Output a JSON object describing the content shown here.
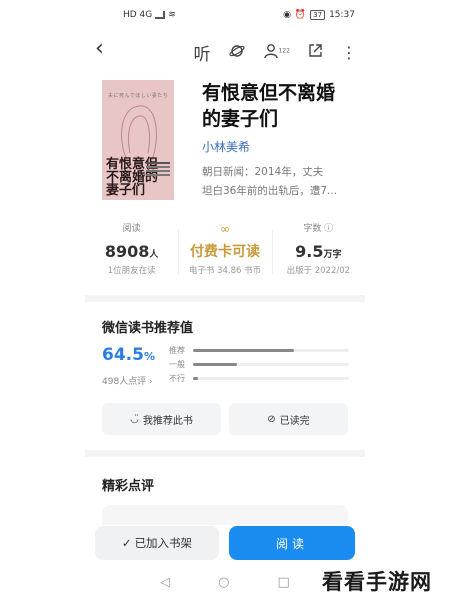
{
  "status_bar": {
    "left_text": "HD 4G",
    "battery": "37",
    "time": "15:37"
  },
  "top_bar": {
    "back_icon": "chevron-left-icon",
    "listen_label": "听",
    "friend_count": "122",
    "icons": [
      "headphone-listen-icon",
      "planet-icon",
      "person-icon",
      "share-icon",
      "more-icon"
    ]
  },
  "book": {
    "cover_top_text": "夫に死んでほしい妻たち",
    "cover_title": "有恨意但\n不离婚的\n妻子们",
    "title": "有恨意但不离婚\n的妻子们",
    "author": "小林美希",
    "intro": "朝日新闻：2014年，丈夫\n坦白36年前的出轨后，遭7..."
  },
  "stats": [
    {
      "label": "阅读",
      "main": "8908",
      "unit": "人",
      "sub": "1位朋友在读"
    },
    {
      "label": "∞",
      "main": "付费卡可读",
      "unit": "",
      "sub": "电子书 34.86 书币"
    },
    {
      "label": "字数 ⓘ",
      "main": "9.5",
      "unit": "万字",
      "sub": "出版于 2022/02"
    }
  ],
  "recommend": {
    "title": "微信读书推荐值",
    "percent": "64.5",
    "percent_unit": "%",
    "count": "498人点评 ›",
    "bars": [
      {
        "label": "推荐",
        "value": 0.65
      },
      {
        "label": "一般",
        "value": 0.28
      },
      {
        "label": "不行",
        "value": 0.03
      }
    ],
    "buttons": [
      {
        "icon": "smile-icon",
        "label": "我推荐此书"
      },
      {
        "icon": "check-circle-icon",
        "label": "已读完"
      }
    ]
  },
  "reviews": {
    "title": "精彩点评"
  },
  "bottom": {
    "shelf_label": "已加入书架",
    "read_label": "阅读"
  },
  "nav": {
    "back": "◁",
    "home": "○",
    "recent": "□"
  },
  "watermark": "看看手游网",
  "colors": {
    "accent": "#1a8cf0",
    "percent": "#2b7de2",
    "gold": "#c89a3a",
    "author": "#3a6fbf"
  }
}
